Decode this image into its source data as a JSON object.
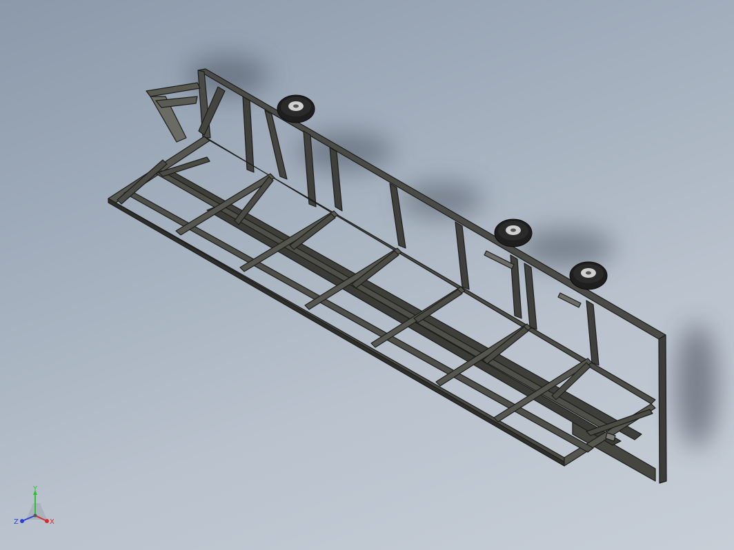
{
  "viewport": {
    "background_top": "#8b99aa",
    "background_bottom": "#c7ced7",
    "model": {
      "frame_color": "#3f403c",
      "frame_edge_color": "#1c1c1a",
      "wheel_color": "#1e1e1e",
      "hub_color": "#d0d0d0"
    }
  },
  "triad": {
    "axes": [
      {
        "label": "Y",
        "color": "#2fbf2f",
        "icon": "y-axis-arrow-icon"
      },
      {
        "label": "Z",
        "color": "#2a3fd8",
        "icon": "z-axis-arrow-icon"
      },
      {
        "label": "X",
        "color": "#d82a2a",
        "icon": "x-axis-arrow-icon"
      }
    ]
  }
}
